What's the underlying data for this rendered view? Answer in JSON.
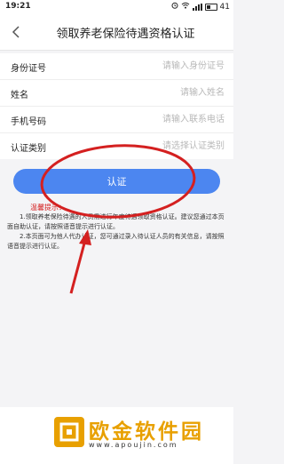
{
  "status_bar": {
    "time": "19:21",
    "battery": "41"
  },
  "nav": {
    "title": "领取养老保险待遇资格认证"
  },
  "form": {
    "rows": [
      {
        "label": "身份证号",
        "placeholder": "请输入身份证号"
      },
      {
        "label": "姓名",
        "placeholder": "请输入姓名"
      },
      {
        "label": "手机号码",
        "placeholder": "请输入联系电话"
      },
      {
        "label": "认证类别",
        "placeholder": "请选择认证类别"
      }
    ]
  },
  "verify_button": {
    "label": "认证"
  },
  "tips": {
    "title": "温馨提示：",
    "items": [
      "1.领取养老保险待遇的人员需进行年度待遇领取资格认证。建议您通过本页面自助认证，请按照语音提示进行认证。",
      "2.本页面可为他人代办认证，您可通过录入待认证人员的有关信息，请按照语音提示进行认证。"
    ]
  },
  "watermark": {
    "name": "欧金软件园",
    "url": "www.apoujin.com"
  },
  "colors": {
    "accent": "#4c86f0",
    "annotation": "#d42020",
    "watermark": "#e8a000"
  }
}
